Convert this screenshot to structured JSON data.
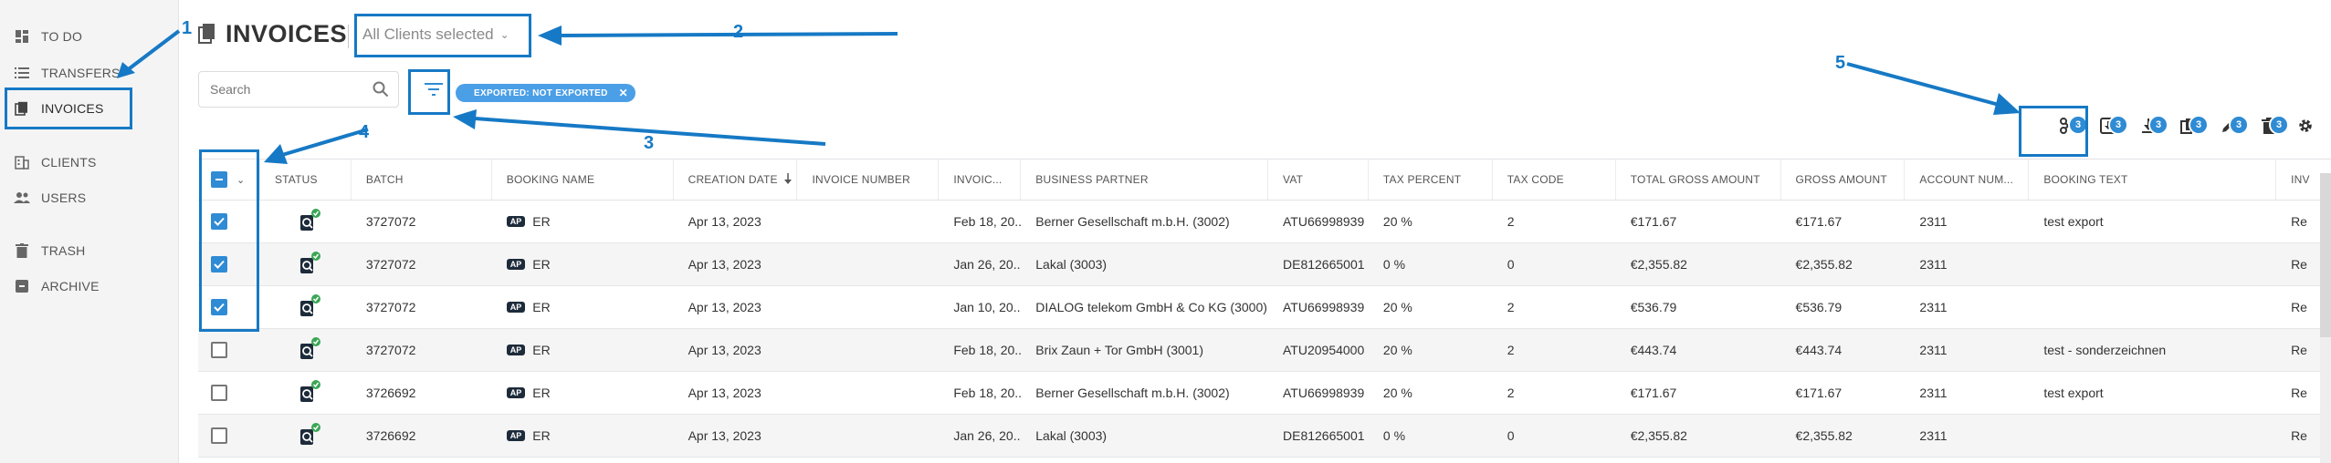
{
  "sidebar": {
    "items": [
      {
        "label": "TO DO",
        "icon": "dashboard-icon"
      },
      {
        "label": "TRANSFERS",
        "icon": "list-icon"
      },
      {
        "label": "INVOICES",
        "icon": "documents-icon",
        "active": true
      },
      {
        "label": "CLIENTS",
        "icon": "building-icon"
      },
      {
        "label": "USERS",
        "icon": "users-icon"
      },
      {
        "label": "TRASH",
        "icon": "trash-icon"
      },
      {
        "label": "ARCHIVE",
        "icon": "archive-icon"
      }
    ]
  },
  "header": {
    "title": "INVOICES",
    "client_select": "All Clients selected"
  },
  "search": {
    "placeholder": "Search"
  },
  "filter_chip": {
    "label": "EXPORTED: NOT EXPORTED"
  },
  "toolbar": {
    "badges": [
      "3",
      "3",
      "3",
      "3",
      "3",
      "3"
    ]
  },
  "callouts": [
    "1",
    "2",
    "3",
    "4",
    "5"
  ],
  "table": {
    "columns": [
      "STATUS",
      "BATCH",
      "BOOKING NAME",
      "CREATION DATE",
      "INVOICE NUMBER",
      "INVOIC...",
      "BUSINESS PARTNER",
      "VAT",
      "TAX PERCENT",
      "TAX CODE",
      "TOTAL GROSS AMOUNT",
      "GROSS AMOUNT",
      "ACCOUNT NUM...",
      "BOOKING TEXT",
      "INV"
    ],
    "rows": [
      {
        "checked": true,
        "batch": "3727072",
        "booking_tag": "AP",
        "booking_name": "ER",
        "creation_date": "Apr 13, 2023",
        "invoice_number": "",
        "invoice_date": "Feb 18, 20...",
        "business_partner": "Berner Gesellschaft m.b.H. (3002)",
        "vat": "ATU66998939",
        "tax_percent": "20 %",
        "tax_code": "2",
        "total_gross": "€171.67",
        "gross": "€171.67",
        "account": "2311",
        "booking_text": "test export",
        "inv": "Re"
      },
      {
        "checked": true,
        "batch": "3727072",
        "booking_tag": "AP",
        "booking_name": "ER",
        "creation_date": "Apr 13, 2023",
        "invoice_number": "",
        "invoice_date": "Jan 26, 20...",
        "business_partner": "Lakal (3003)",
        "vat": "DE812665001",
        "tax_percent": "0 %",
        "tax_code": "0",
        "total_gross": "€2,355.82",
        "gross": "€2,355.82",
        "account": "2311",
        "booking_text": "",
        "inv": "Re"
      },
      {
        "checked": true,
        "batch": "3727072",
        "booking_tag": "AP",
        "booking_name": "ER",
        "creation_date": "Apr 13, 2023",
        "invoice_number": "",
        "invoice_date": "Jan 10, 20...",
        "business_partner": "DIALOG telekom GmbH & Co KG (3000)",
        "vat": "ATU66998939",
        "tax_percent": "20 %",
        "tax_code": "2",
        "total_gross": "€536.79",
        "gross": "€536.79",
        "account": "2311",
        "booking_text": "",
        "inv": "Re"
      },
      {
        "checked": false,
        "batch": "3727072",
        "booking_tag": "AP",
        "booking_name": "ER",
        "creation_date": "Apr 13, 2023",
        "invoice_number": "",
        "invoice_date": "Feb 18, 20...",
        "business_partner": "Brix Zaun + Tor GmbH (3001)",
        "vat": "ATU20954000",
        "tax_percent": "20 %",
        "tax_code": "2",
        "total_gross": "€443.74",
        "gross": "€443.74",
        "account": "2311",
        "booking_text": "test - sonderzeichnen",
        "inv": "Re"
      },
      {
        "checked": false,
        "batch": "3726692",
        "booking_tag": "AP",
        "booking_name": "ER",
        "creation_date": "Apr 13, 2023",
        "invoice_number": "",
        "invoice_date": "Feb 18, 20...",
        "business_partner": "Berner Gesellschaft m.b.H. (3002)",
        "vat": "ATU66998939",
        "tax_percent": "20 %",
        "tax_code": "2",
        "total_gross": "€171.67",
        "gross": "€171.67",
        "account": "2311",
        "booking_text": "test export",
        "inv": "Re"
      },
      {
        "checked": false,
        "batch": "3726692",
        "booking_tag": "AP",
        "booking_name": "ER",
        "creation_date": "Apr 13, 2023",
        "invoice_number": "",
        "invoice_date": "Jan 26, 20...",
        "business_partner": "Lakal (3003)",
        "vat": "DE812665001",
        "tax_percent": "0 %",
        "tax_code": "0",
        "total_gross": "€2,355.82",
        "gross": "€2,355.82",
        "account": "2311",
        "booking_text": "",
        "inv": "Re"
      }
    ]
  },
  "colors": {
    "accent": "#2e8bd4",
    "callout": "#1679c5",
    "chip": "#4b9fe6",
    "status_ok": "#3aa655"
  }
}
